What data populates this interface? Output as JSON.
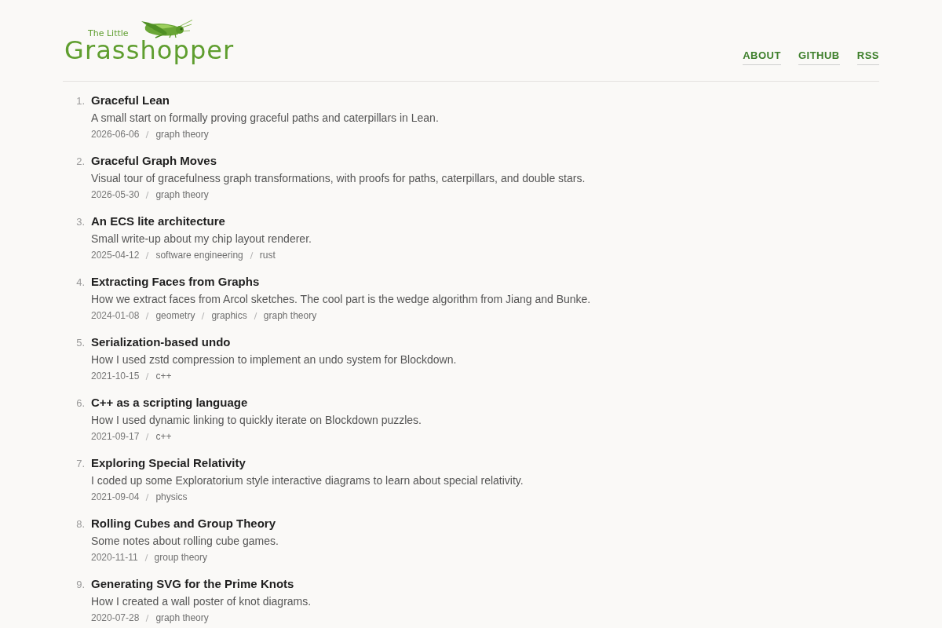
{
  "header": {
    "logo": {
      "small_text": "The Little",
      "large_text": "Grasshopper"
    },
    "nav": [
      {
        "label": "ABOUT"
      },
      {
        "label": "GITHUB"
      },
      {
        "label": "RSS"
      }
    ]
  },
  "posts": [
    {
      "number": "1.",
      "title": "Graceful Lean",
      "summary": "A small start on formally proving graceful paths and caterpillars in Lean.",
      "date": "2026-06-06",
      "tags": [
        "graph theory"
      ]
    },
    {
      "number": "2.",
      "title": "Graceful Graph Moves",
      "summary": "Visual tour of gracefulness graph transformations, with proofs for paths, caterpillars, and double stars.",
      "date": "2026-05-30",
      "tags": [
        "graph theory"
      ]
    },
    {
      "number": "3.",
      "title": "An ECS lite architecture",
      "summary": "Small write-up about my chip layout renderer.",
      "date": "2025-04-12",
      "tags": [
        "software engineering",
        "rust"
      ]
    },
    {
      "number": "4.",
      "title": "Extracting Faces from Graphs",
      "summary": "How we extract faces from Arcol sketches. The cool part is the wedge algorithm from Jiang and Bunke.",
      "date": "2024-01-08",
      "tags": [
        "geometry",
        "graphics",
        "graph theory"
      ]
    },
    {
      "number": "5.",
      "title": "Serialization-based undo",
      "summary": "How I used zstd compression to implement an undo system for Blockdown.",
      "date": "2021-10-15",
      "tags": [
        "c++"
      ]
    },
    {
      "number": "6.",
      "title": "C++ as a scripting language",
      "summary": "How I used dynamic linking to quickly iterate on Blockdown puzzles.",
      "date": "2021-09-17",
      "tags": [
        "c++"
      ]
    },
    {
      "number": "7.",
      "title": "Exploring Special Relativity",
      "summary": "I coded up some Exploratorium style interactive diagrams to learn about special relativity.",
      "date": "2021-09-04",
      "tags": [
        "physics"
      ]
    },
    {
      "number": "8.",
      "title": "Rolling Cubes and Group Theory",
      "summary": "Some notes about rolling cube games.",
      "date": "2020-11-11",
      "tags": [
        "group theory"
      ]
    },
    {
      "number": "9.",
      "title": "Generating SVG for the Prime Knots",
      "summary": "How I created a wall poster of knot diagrams.",
      "date": "2020-07-28",
      "tags": [
        "graph theory"
      ]
    }
  ]
}
